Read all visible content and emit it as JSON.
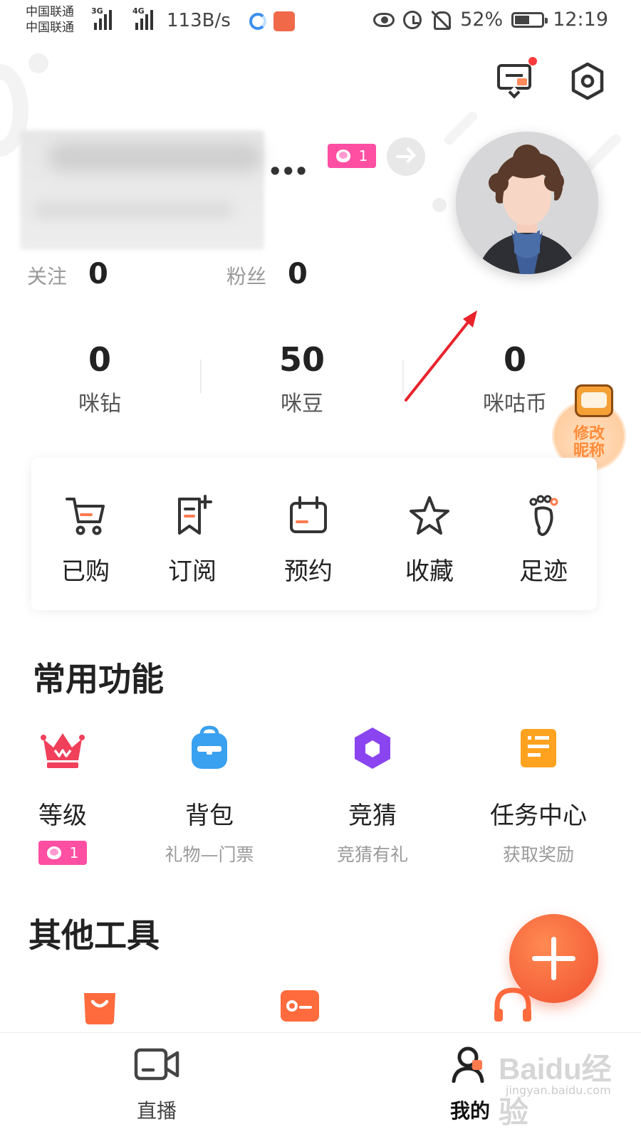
{
  "status_bar": {
    "carrier_1": "中国联通",
    "carrier_2": "中国联通",
    "signal_1_label": "3G",
    "signal_2_label": "4G",
    "net_speed": "113B/s",
    "battery": "52%",
    "time": "12:19"
  },
  "header": {
    "message_icon": "message-icon",
    "settings_icon": "settings-hex-icon"
  },
  "profile": {
    "name_truncated": "•••",
    "level": "1",
    "follow_label": "关注",
    "follow_count": "0",
    "fans_label": "粉丝",
    "fans_count": "0"
  },
  "wallet": [
    {
      "value": "0",
      "label": "咪钻"
    },
    {
      "value": "50",
      "label": "咪豆"
    },
    {
      "value": "0",
      "label": "咪咕币"
    }
  ],
  "mascot": {
    "line1": "修改",
    "line2": "昵称"
  },
  "quick_actions": [
    {
      "label": "已购",
      "icon": "cart-icon"
    },
    {
      "label": "订阅",
      "icon": "bookmark-add-icon"
    },
    {
      "label": "预约",
      "icon": "calendar-icon"
    },
    {
      "label": "收藏",
      "icon": "star-icon"
    },
    {
      "label": "足迹",
      "icon": "footprint-icon"
    }
  ],
  "common_features": {
    "title": "常用功能",
    "items": [
      {
        "name": "等级",
        "sub": "",
        "level": "1",
        "icon": "crown-icon",
        "color": "#f0405a"
      },
      {
        "name": "背包",
        "sub": "礼物—门票",
        "icon": "backpack-icon",
        "color": "#3aa0f0"
      },
      {
        "name": "竞猜",
        "sub": "竞猜有礼",
        "icon": "hexagon-icon",
        "color": "#8a45f0"
      },
      {
        "name": "任务中心",
        "sub": "获取奖励",
        "icon": "task-icon",
        "color": "#ffa21f"
      }
    ]
  },
  "other_tools": {
    "title": "其他工具",
    "icons": [
      "shopping-bag-icon",
      "ticket-icon",
      "headset-icon"
    ]
  },
  "tabs": [
    {
      "label": "直播",
      "icon": "live-camera-icon"
    },
    {
      "label": "我的",
      "icon": "user-icon"
    }
  ],
  "watermark": {
    "text": "Baidu经验",
    "sub": "jingyan.baidu.com"
  }
}
